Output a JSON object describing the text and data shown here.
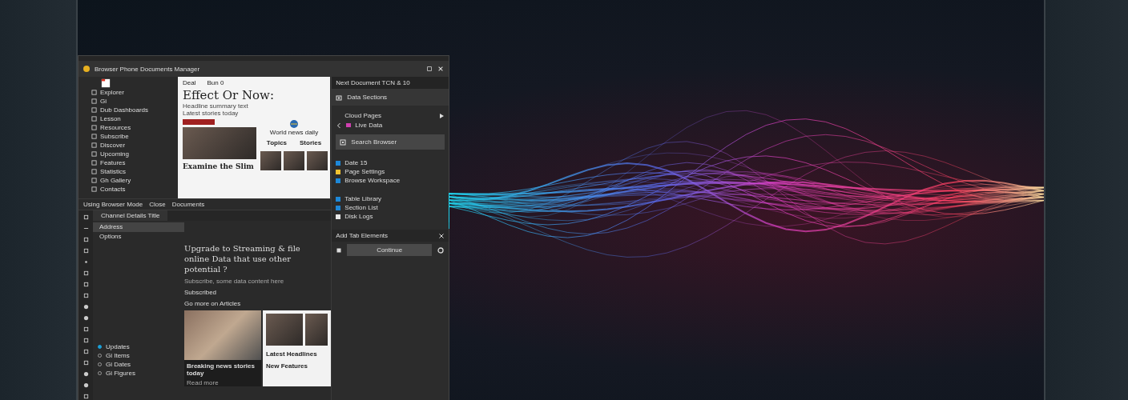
{
  "window": {
    "title": "Browser Phone Documents Manager"
  },
  "tree": {
    "items": [
      {
        "label": "Explorer"
      },
      {
        "label": "Gi"
      },
      {
        "label": "Dub Dashboards"
      },
      {
        "label": "Lesson"
      },
      {
        "label": "Resources"
      },
      {
        "label": "Subscribe"
      },
      {
        "label": "Discover"
      },
      {
        "label": "Upcoming"
      },
      {
        "label": "Features"
      },
      {
        "label": "Statistics"
      },
      {
        "label": "Gh Gallery"
      },
      {
        "label": "Contacts"
      }
    ]
  },
  "preview": {
    "toolbar": [
      "Deal",
      "Bun 0"
    ],
    "headline": "Effect Or Now:",
    "subline": "Headline summary text",
    "body": "Latest stories today",
    "side_caption": "World news daily",
    "side_headings": [
      "Topics",
      "Stories"
    ],
    "feature": "Examine the Slim"
  },
  "status_bar": {
    "items": [
      "Using Browser Mode",
      "Close",
      "Documents"
    ]
  },
  "panel": {
    "title": "Next Document TCN & 10",
    "account": "Data Sections",
    "section": "Cloud Pages",
    "back_item": "Live Data",
    "action": "Search Browser",
    "group_1": [
      {
        "label": "Date 15",
        "color": "#1e88d8"
      },
      {
        "label": "Page Settings",
        "color": "#f2c230"
      },
      {
        "label": "Browse Workspace",
        "color": "#1e88d8"
      }
    ],
    "group_2": [
      {
        "label": "Table Library",
        "color": "#1e88d8"
      },
      {
        "label": "Section List",
        "color": "#1e88d8"
      },
      {
        "label": "Disk Logs",
        "color": "#e8e8e8"
      }
    ],
    "footer": "Add Tab Elements",
    "button": "Continue"
  },
  "lower": {
    "tab": "Channel Details Title",
    "nav": [
      {
        "label": "Address",
        "selected": true
      },
      {
        "label": "Options",
        "selected": false
      }
    ],
    "heading": "Upgrade to Streaming & file online Data that use other potential ?",
    "subtext": "Subscribe, some data content here",
    "label": "Subscribed",
    "sublabel": "Go more on Articles",
    "legend": [
      {
        "label": "Updates",
        "selected": true
      },
      {
        "label": "Gi Items",
        "selected": false
      },
      {
        "label": "Gi Dates",
        "selected": false
      },
      {
        "label": "Gi Figures",
        "selected": false
      }
    ],
    "card_caption": "Breaking news stories today",
    "card_text": "Read more",
    "article_headings": [
      "Latest Headlines",
      "New Features"
    ]
  }
}
